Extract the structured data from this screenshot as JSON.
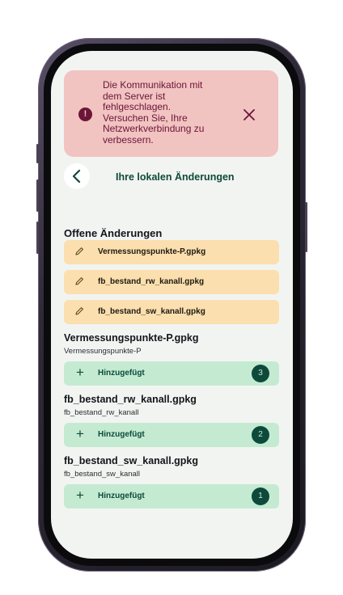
{
  "alert": {
    "message_lines": [
      "Die Kommunikation mit",
      "dem Server ist",
      "fehlgeschlagen.",
      "Versuchen Sie, Ihre",
      "Netzwerkverbindung zu",
      "verbessern."
    ],
    "icon": "error-icon",
    "close_icon": "close-icon"
  },
  "header": {
    "back_icon": "chevron-left-icon",
    "title": "Ihre lokalen Änderungen"
  },
  "pending": {
    "title": "Offene Änderungen",
    "items": [
      {
        "label": "Vermessungspunkte-P.gpkg",
        "icon": "pencil-icon"
      },
      {
        "label": "fb_bestand_rw_kanall.gpkg",
        "icon": "pencil-icon"
      },
      {
        "label": "fb_bestand_sw_kanall.gpkg",
        "icon": "pencil-icon"
      }
    ]
  },
  "files": [
    {
      "title": "Vermessungspunkte-P.gpkg",
      "subtitle": "Vermessungspunkte-P",
      "change_label": "Hinzugefügt",
      "count": "3"
    },
    {
      "title": "fb_bestand_rw_kanall.gpkg",
      "subtitle": "fb_bestand_rw_kanall",
      "change_label": "Hinzugefügt",
      "count": "2"
    },
    {
      "title": "fb_bestand_sw_kanall.gpkg",
      "subtitle": "fb_bestand_sw_kanall",
      "change_label": "Hinzugefügt",
      "count": "1"
    }
  ],
  "colors": {
    "alert_bg": "#f1c3c1",
    "alert_fg": "#6b1537",
    "pending_bg": "#fbdfae",
    "added_bg": "#c4ebd2",
    "primary": "#0d4a3b",
    "screen_bg": "#f2f4f2"
  }
}
